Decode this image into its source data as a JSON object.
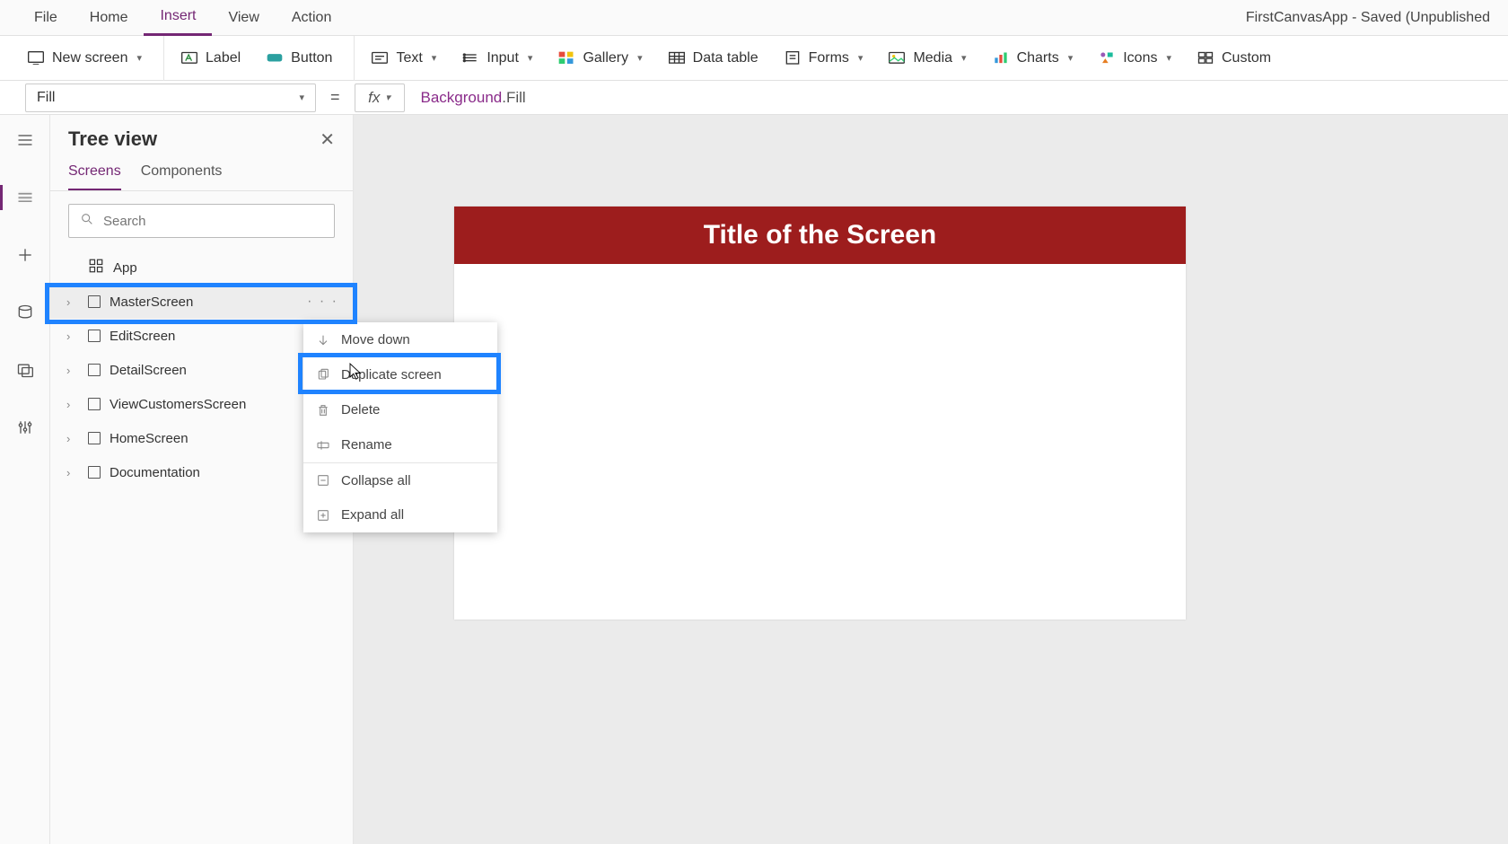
{
  "menubar": {
    "items": [
      "File",
      "Home",
      "Insert",
      "View",
      "Action"
    ],
    "active_index": 2,
    "app_title": "FirstCanvasApp - Saved (Unpublished"
  },
  "ribbon": {
    "new_screen": "New screen",
    "label": "Label",
    "button": "Button",
    "text": "Text",
    "input": "Input",
    "gallery": "Gallery",
    "data_table": "Data table",
    "forms": "Forms",
    "media": "Media",
    "charts": "Charts",
    "icons": "Icons",
    "custom": "Custom"
  },
  "formula": {
    "property": "Fill",
    "fx": "fx",
    "expr_obj": "Background",
    "expr_dot": ".",
    "expr_prop": "Fill"
  },
  "tree": {
    "title": "Tree view",
    "tabs": {
      "screens": "Screens",
      "components": "Components"
    },
    "search_placeholder": "Search",
    "app_node": "App",
    "screens": [
      "MasterScreen",
      "EditScreen",
      "DetailScreen",
      "ViewCustomersScreen",
      "HomeScreen",
      "Documentation"
    ],
    "ellipsis": "· · ·"
  },
  "context_menu": {
    "move_down": "Move down",
    "duplicate": "Duplicate screen",
    "delete": "Delete",
    "rename": "Rename",
    "collapse_all": "Collapse all",
    "expand_all": "Expand all"
  },
  "canvas": {
    "title": "Title of the Screen"
  },
  "colors": {
    "accent": "#742774",
    "highlight": "#1f83ff",
    "canvas_title_bg": "#9d1d1d"
  }
}
